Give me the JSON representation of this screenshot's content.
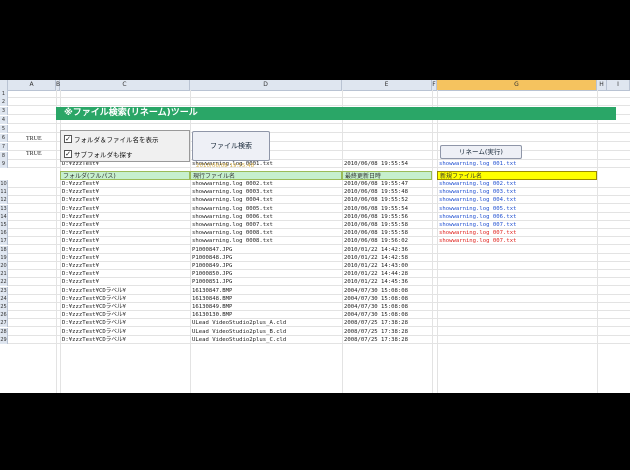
{
  "columns": [
    "A",
    "B",
    "C",
    "D",
    "E",
    "F",
    "G",
    "H",
    "I"
  ],
  "title": "※ファイル検索(リネーム)ツール",
  "flags": [
    "TRUE",
    "TRUE"
  ],
  "checkboxes": [
    {
      "label": "フォルダ＆ファイル名を表示",
      "checked": true
    },
    {
      "label": "サブフォルダも探す",
      "checked": true
    }
  ],
  "search_button": "ファイル検索",
  "rename_button": "リネーム(実行)",
  "hint": "2010/06/08 19:55:48",
  "headers": {
    "folder": "フォルダ(フルパス)",
    "current": "現行ファイル名",
    "modified": "最終更新日時",
    "new_name": "新規ファイル名"
  },
  "row_numbers": [
    "1",
    "2",
    "3",
    "4",
    "5",
    "6",
    "7",
    "8",
    "9",
    "10",
    "11",
    "12",
    "13",
    "14",
    "15",
    "16",
    "17",
    "18",
    "19",
    "20",
    "21",
    "22",
    "23",
    "24",
    "25",
    "26",
    "27",
    "28",
    "29"
  ],
  "rows": [
    {
      "folder": "D:¥zzzTest¥",
      "file": "showwarning.log 0001.txt",
      "date": "2010/06/08 19:55:54",
      "new": "showwarning.log 001.txt",
      "new_color": "#1f4fd1"
    },
    {
      "folder": "D:¥zzzTest¥",
      "file": "showwarning.log 0002.txt",
      "date": "2010/06/08 19:55:47",
      "new": "showwarning.log 002.txt",
      "new_color": "#1f4fd1"
    },
    {
      "folder": "D:¥zzzTest¥",
      "file": "showwarning.log 0003.txt",
      "date": "2010/06/08 19:55:48",
      "new": "showwarning.log 003.txt",
      "new_color": "#1f4fd1"
    },
    {
      "folder": "D:¥zzzTest¥",
      "file": "showwarning.log 0004.txt",
      "date": "2010/06/08 19:55:52",
      "new": "showwarning.log 004.txt",
      "new_color": "#1f4fd1"
    },
    {
      "folder": "D:¥zzzTest¥",
      "file": "showwarning.log 0005.txt",
      "date": "2010/06/08 19:55:54",
      "new": "showwarning.log 005.txt",
      "new_color": "#1f4fd1"
    },
    {
      "folder": "D:¥zzzTest¥",
      "file": "showwarning.log 0006.txt",
      "date": "2010/06/08 19:55:56",
      "new": "showwarning.log 006.txt",
      "new_color": "#1f4fd1"
    },
    {
      "folder": "D:¥zzzTest¥",
      "file": "showwarning.log 0007.txt",
      "date": "2010/06/08 19:55:58",
      "new": "showwarning.log 007.txt",
      "new_color": "#1f4fd1"
    },
    {
      "folder": "D:¥zzzTest¥",
      "file": "showwarning.log 0008.txt",
      "date": "2010/06/08 19:55:58",
      "new": "showwarning.log 007.txt",
      "new_color": "#e0201a"
    },
    {
      "folder": "D:¥zzzTest¥",
      "file": "showwarning.log 0008.txt",
      "date": "2010/06/08 19:56:02",
      "new": "showwarning.log 007.txt",
      "new_color": "#e0201a"
    },
    {
      "folder": "D:¥zzzTest¥",
      "file": "P1000847.JPG",
      "date": "2010/01/22 14:42:36",
      "new": "",
      "new_color": "#1f4fd1"
    },
    {
      "folder": "D:¥zzzTest¥",
      "file": "P1000848.JPG",
      "date": "2010/01/22 14:42:58",
      "new": "",
      "new_color": "#1f4fd1"
    },
    {
      "folder": "D:¥zzzTest¥",
      "file": "P1000849.JPG",
      "date": "2010/01/22 14:43:00",
      "new": "",
      "new_color": "#1f4fd1"
    },
    {
      "folder": "D:¥zzzTest¥",
      "file": "P1000850.JPG",
      "date": "2010/01/22 14:44:28",
      "new": "",
      "new_color": "#1f4fd1"
    },
    {
      "folder": "D:¥zzzTest¥",
      "file": "P1000851.JPG",
      "date": "2010/01/22 14:45:36",
      "new": "",
      "new_color": "#1f4fd1"
    },
    {
      "folder": "D:¥zzzTest¥CDラベル¥",
      "file": "16130847.BMP",
      "date": "2004/07/30 15:08:08",
      "new": "",
      "new_color": "#1f4fd1"
    },
    {
      "folder": "D:¥zzzTest¥CDラベル¥",
      "file": "16130848.BMP",
      "date": "2004/07/30 15:08:08",
      "new": "",
      "new_color": "#1f4fd1"
    },
    {
      "folder": "D:¥zzzTest¥CDラベル¥",
      "file": "16130849.BMP",
      "date": "2004/07/30 15:08:08",
      "new": "",
      "new_color": "#1f4fd1"
    },
    {
      "folder": "D:¥zzzTest¥CDラベル¥",
      "file": "16130130.BMP",
      "date": "2004/07/30 15:08:08",
      "new": "",
      "new_color": "#1f4fd1"
    },
    {
      "folder": "D:¥zzzTest¥CDラベル¥",
      "file": "ULead VideoStudio2plus_A.cld",
      "date": "2008/07/25 17:38:28",
      "new": "",
      "new_color": "#1f4fd1"
    },
    {
      "folder": "D:¥zzzTest¥CDラベル¥",
      "file": "ULead VideoStudio2plus_B.cld",
      "date": "2008/07/25 17:38:28",
      "new": "",
      "new_color": "#1f4fd1"
    },
    {
      "folder": "D:¥zzzTest¥CDラベル¥",
      "file": "ULead VideoStudio2plus_C.cld",
      "date": "2008/07/25 17:38:28",
      "new": "",
      "new_color": "#1f4fd1"
    }
  ]
}
